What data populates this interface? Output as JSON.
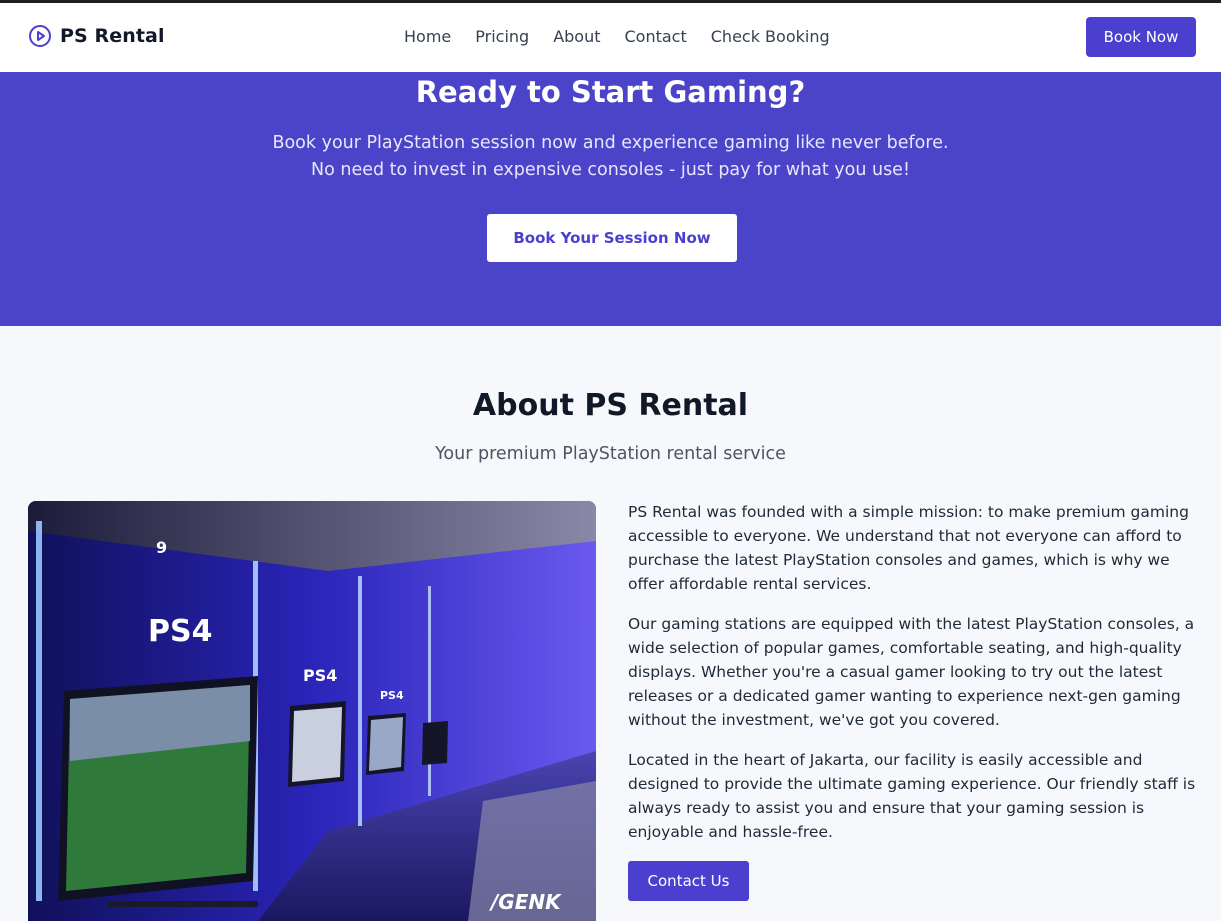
{
  "brand": {
    "name": "PS Rental",
    "icon": "play-circle-icon",
    "color": "#4b3fd0"
  },
  "nav": {
    "links": [
      "Home",
      "Pricing",
      "About",
      "Contact",
      "Check Booking"
    ],
    "cta_label": "Book Now"
  },
  "cta": {
    "title": "Ready to Start Gaming?",
    "subtitle_line1": "Book your PlayStation session now and experience gaming like never before.",
    "subtitle_line2": "No need to invest in expensive consoles - just pay for what you use!",
    "button_label": "Book Your Session Now",
    "background": "#4b44c8"
  },
  "about": {
    "title": "About PS Rental",
    "subtitle": "Your premium PlayStation rental service",
    "image_watermark": "/GENK",
    "paragraphs": [
      "PS Rental was founded with a simple mission: to make premium gaming accessible to everyone. We understand that not everyone can afford to purchase the latest PlayStation consoles and games, which is why we offer affordable rental services.",
      "Our gaming stations are equipped with the latest PlayStation consoles, a wide selection of popular games, comfortable seating, and high-quality displays. Whether you're a casual gamer looking to try out the latest releases or a dedicated gamer wanting to experience next-gen gaming without the investment, we've got you covered.",
      "Located in the heart of Jakarta, our facility is easily accessible and designed to provide the ultimate gaming experience. Our friendly staff is always ready to assist you and ensure that your gaming session is enjoyable and hassle-free."
    ],
    "contact_button_label": "Contact Us"
  }
}
